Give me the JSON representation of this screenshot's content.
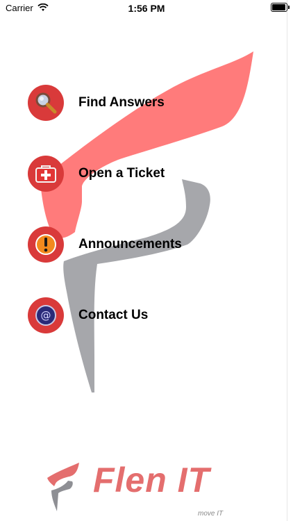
{
  "status": {
    "carrier": "Carrier",
    "time": "1:56 PM"
  },
  "menu": {
    "items": [
      {
        "label": "Find Answers",
        "icon": "magnifier-icon"
      },
      {
        "label": "Open a Ticket",
        "icon": "first-aid-kit-icon"
      },
      {
        "label": "Announcements",
        "icon": "exclamation-icon"
      },
      {
        "label": "Contact Us",
        "icon": "at-sign-icon"
      }
    ]
  },
  "brand": {
    "name": "Flen IT",
    "tagline": "move IT"
  },
  "colors": {
    "accent": "#d93a3a",
    "logo_red": "#ff7b7b",
    "logo_gray": "#a6a7ab"
  }
}
